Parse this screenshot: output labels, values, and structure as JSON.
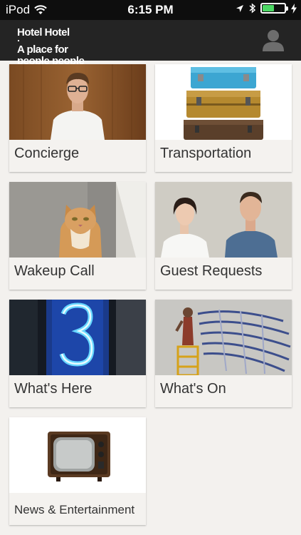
{
  "status_bar": {
    "device": "iPod",
    "time": "6:15 PM",
    "battery_level": 0.5,
    "battery_color": "#4cd964",
    "icons": [
      "wifi-icon",
      "location-arrow-icon",
      "bluetooth-icon",
      "battery-icon",
      "charging-bolt-icon"
    ]
  },
  "header": {
    "brand_name": "Hotel Hotel",
    "tagline_line1": "A place for",
    "tagline_line2": "people people",
    "profile_icon": "user-profile-icon",
    "background": "#242424"
  },
  "tiles": [
    {
      "label": "Concierge",
      "image": "man-in-white-tshirt-photo"
    },
    {
      "label": "Transportation",
      "image": "stacked-suitcases-photo"
    },
    {
      "label": "Wakeup Call",
      "image": "cat-photo"
    },
    {
      "label": "Guest Requests",
      "image": "couple-portrait-photo"
    },
    {
      "label": "What's Here",
      "image": "neon-number-three-photo"
    },
    {
      "label": "What's On",
      "image": "mural-painter-photo"
    },
    {
      "label": "News & Entertainment",
      "image": "vintage-television-photo"
    }
  ]
}
